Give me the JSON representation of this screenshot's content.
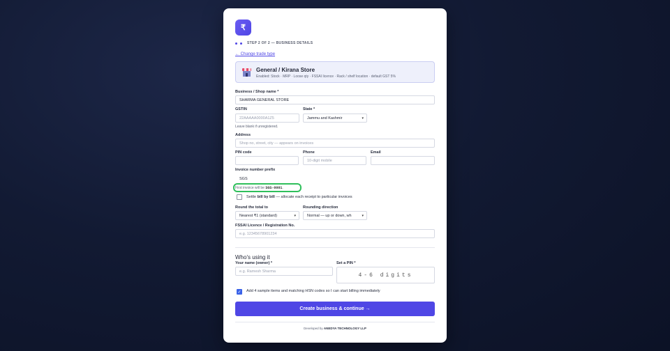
{
  "logo": {
    "glyph": "₹"
  },
  "step": {
    "text": "STEP 2 OF 2 — BUSINESS DETAILS"
  },
  "change_link": "← Change trade type",
  "trade": {
    "title": "General / Kirana Store",
    "subtitle": "Enabled: Stock · MRP · Loose qty · FSSAI licence · Rack / shelf location · default GST 5%"
  },
  "business_name": {
    "label": "Business / Shop name *",
    "value": "SHARMA GENERAL STORE"
  },
  "gstin": {
    "label": "GSTIN",
    "placeholder": "22AAAAA0000A1Z5",
    "help": "Leave blank if unregistered."
  },
  "state": {
    "label": "State *",
    "value": "Jammu and Kashmir"
  },
  "address": {
    "label": "Address",
    "placeholder": "Shop no, street, city — appears on invoices"
  },
  "pin_code": {
    "label": "PIN code",
    "value": ""
  },
  "phone": {
    "label": "Phone",
    "placeholder": "10-digit mobile"
  },
  "email": {
    "label": "Email",
    "value": ""
  },
  "invoice_prefix": {
    "label": "Invoice number prefix",
    "value": "SGS",
    "help_prefix": "First invoice will be ",
    "help_code": "SGS-0001",
    "help_suffix": "."
  },
  "settle": {
    "text_prefix": "Settle ",
    "text_bold": "bill by bill",
    "text_suffix": " — allocate each receipt to particular invoices",
    "checked": false
  },
  "round_total": {
    "label": "Round the total to",
    "value": "Nearest ₹1 (standard)"
  },
  "rounding_direction": {
    "label": "Rounding direction",
    "value": "Normal — up or down, wh"
  },
  "fssai": {
    "label": "FSSAI Licence / Registration No.",
    "placeholder": "e.g. 12345678901234"
  },
  "section_title": "Who's using it",
  "owner_name": {
    "label": "Your name (owner) *",
    "placeholder": "e.g. Ramesh Sharma"
  },
  "set_pin": {
    "label": "Set a PIN *",
    "placeholder": "4-6 digits"
  },
  "sample_items": {
    "text": "Add 4 sample items and matching HSN codes so I can start billing immediately",
    "checked": true
  },
  "cta": {
    "label": "Create business & continue →"
  },
  "footer": {
    "prefix": "Developed by ",
    "company": "ANEDYA TECHNOLOGY LLP"
  },
  "colors": {
    "accent": "#4f46e5",
    "highlight": "#2fbf5b",
    "checkbox": "#3b63e8"
  }
}
